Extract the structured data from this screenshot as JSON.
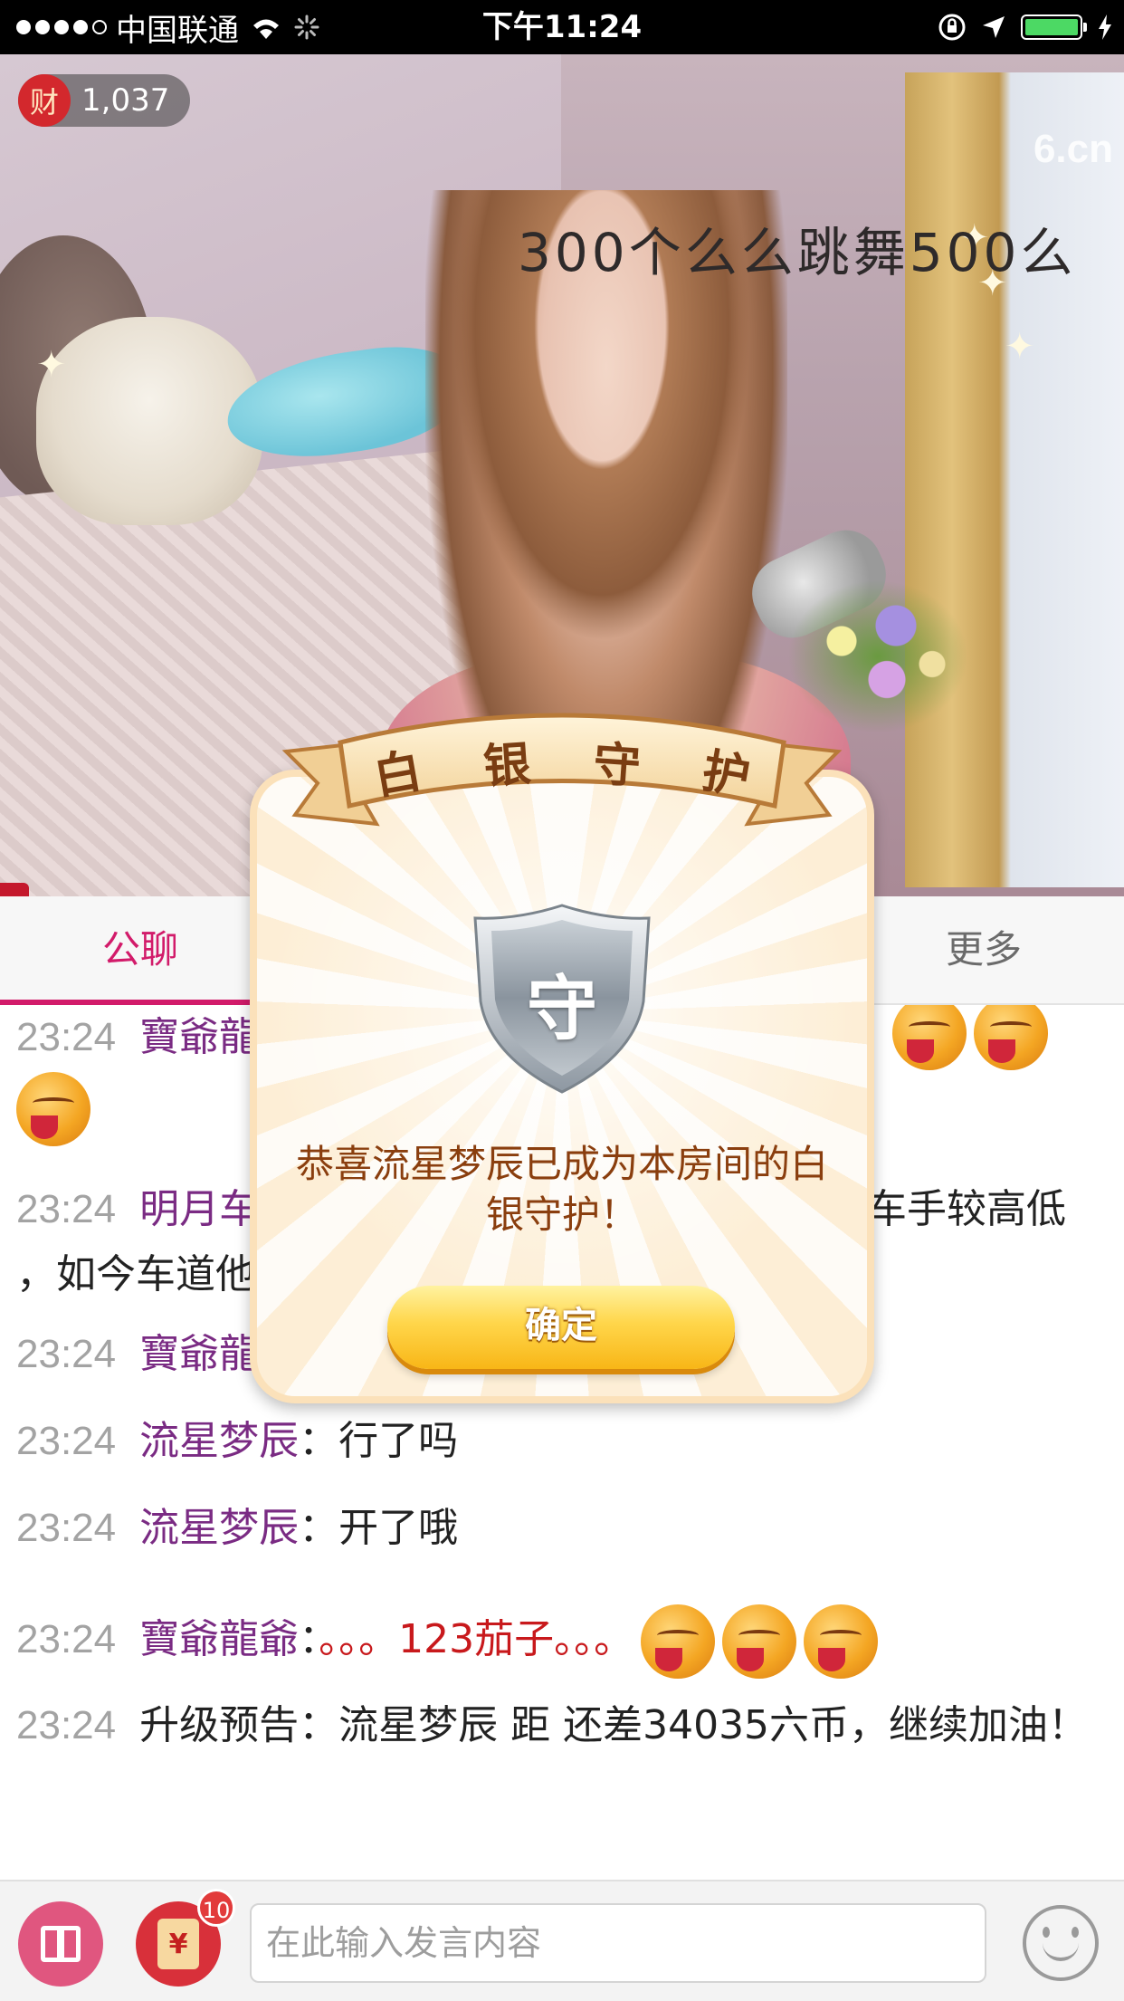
{
  "status_bar": {
    "carrier": "中国联通",
    "time": "下午11:24",
    "signal_bars_filled": 4,
    "signal_bars_total": 5,
    "battery_level": 1.0
  },
  "video": {
    "wealth_badge_icon": "财",
    "wealth_count": "1,037",
    "logo": "6.cn",
    "caption": "300个么么跳舞500么"
  },
  "tabs": {
    "public_chat": "公聊",
    "more": "更多"
  },
  "chat": {
    "messages": [
      {
        "time": "23:24",
        "user": "寶爺龍",
        "text": ""
      },
      {
        "time": "23:24",
        "user": "明月车",
        "text": "车手较高低",
        "text2": "，如今车道他"
      },
      {
        "time": "23:24",
        "user": "寶爺龍爺",
        "text": ""
      },
      {
        "time": "23:24",
        "user": "流星梦辰",
        "text": "行了吗"
      },
      {
        "time": "23:24",
        "user": "流星梦辰",
        "text": "开了哦"
      },
      {
        "time": "23:24",
        "user": "寶爺龍爺",
        "text": "。。。123茄子。。。"
      },
      {
        "time": "23:24",
        "label": "升级预告",
        "text": "流星梦辰 距 还差34035六币，继续加油！"
      }
    ],
    "colon": "："
  },
  "modal": {
    "ribbon_title": [
      "白",
      "银",
      "守",
      "护"
    ],
    "shield_char": "守",
    "message": "恭喜流星梦辰已成为本房间的白银守护！",
    "confirm_label": "确定"
  },
  "input_bar": {
    "placeholder": "在此输入发言内容",
    "redpack_symbol": "¥",
    "redpack_badge": "10"
  },
  "colors": {
    "accent": "#d21b6a",
    "username": "#7a2b83",
    "timestamp": "#a3a3a3",
    "modal_text": "#8a3e0e",
    "button_gold": "#ffd64a"
  },
  "icons": {
    "wifi": "wifi-icon",
    "loading": "activity-spinner-icon",
    "lock": "orientation-lock-icon",
    "location": "location-arrow-icon",
    "charging": "bolt-icon",
    "gift": "gift-icon",
    "redpack": "red-envelope-icon",
    "emoji": "smiley-icon"
  }
}
